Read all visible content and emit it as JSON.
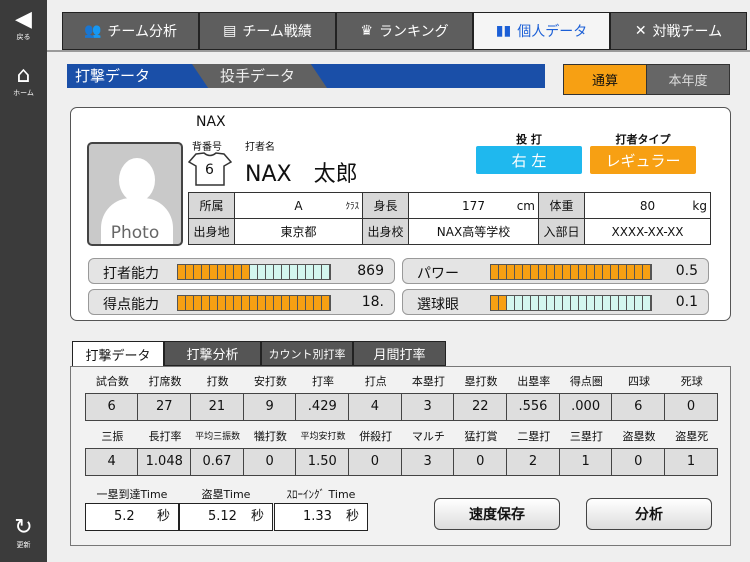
{
  "sidebar": {
    "back": "戻る",
    "home": "ホーム",
    "refresh": "更新"
  },
  "nav": {
    "tabs": [
      "チーム分析",
      "チーム戦績",
      "ランキング",
      "個人データ",
      "対戦チーム"
    ],
    "active": 3
  },
  "subtabs": {
    "batting": "打撃データ",
    "pitching": "投手データ"
  },
  "period": {
    "total": "通算",
    "this_year": "本年度",
    "active": "通算"
  },
  "profile": {
    "team": "NAX",
    "number_label": "背番号",
    "number": "6",
    "name_label": "打者名",
    "name": "NAX　太郎",
    "photo": "Photo",
    "throw_bat_label": "投 打",
    "throw_bat": "右 左",
    "type_label": "打者タイプ",
    "type": "レギュラー",
    "info": [
      [
        {
          "l": "所属",
          "v": "A",
          "u": "ｸﾗｽ"
        },
        {
          "l": "身長",
          "v": "177",
          "u": "cm"
        },
        {
          "l": "体重",
          "v": "80",
          "u": "kg"
        }
      ],
      [
        {
          "l": "出身地",
          "v": "東京都",
          "u": ""
        },
        {
          "l": "出身校",
          "v": "NAX高等学校",
          "u": ""
        },
        {
          "l": "入部日",
          "v": "XXXX-XX-XX",
          "u": ""
        }
      ]
    ]
  },
  "abilities": [
    {
      "name": "打者能力",
      "value": "869",
      "fill": 9,
      "total": 19
    },
    {
      "name": "パワー",
      "value": "0.5",
      "fill": 20,
      "total": 20
    },
    {
      "name": "得点能力",
      "value": "18.",
      "fill": 19,
      "total": 19
    },
    {
      "name": "選球眼",
      "value": "0.1",
      "fill": 2,
      "total": 20
    }
  ],
  "lower_tabs": [
    "打撃データ",
    "打撃分析",
    "カウント別打率",
    "月間打率"
  ],
  "stats1": {
    "headers": [
      "試合数",
      "打席数",
      "打数",
      "安打数",
      "打率",
      "打点",
      "本塁打",
      "塁打数",
      "出塁率",
      "得点圏",
      "四球",
      "死球"
    ],
    "values": [
      "6",
      "27",
      "21",
      "9",
      ".429",
      "4",
      "3",
      "22",
      ".556",
      ".000",
      "6",
      "0"
    ]
  },
  "stats2": {
    "headers": [
      "三振",
      "長打率",
      "平均三振数",
      "犠打数",
      "平均安打数",
      "併殺打",
      "マルチ",
      "猛打賞",
      "二塁打",
      "三塁打",
      "盗塁数",
      "盗塁死"
    ],
    "values": [
      "4",
      "1.048",
      "0.67",
      "0",
      "1.50",
      "0",
      "3",
      "0",
      "2",
      "1",
      "0",
      "1"
    ]
  },
  "times": [
    {
      "label": "一塁到達Time",
      "value": "5.2",
      "unit": "秒"
    },
    {
      "label": "盗塁Time",
      "value": "5.12",
      "unit": "秒"
    },
    {
      "label": "ｽﾛｰｲﾝｸﾞ Time",
      "value": "1.33",
      "unit": "秒"
    }
  ],
  "buttons": {
    "save_speed": "速度保存",
    "analyze": "分析"
  },
  "colors": {
    "orange": "#f7a013",
    "cyan": "#1fb8ee",
    "blue": "#1a4fa8",
    "bar_empty": "#d4f7ef"
  }
}
